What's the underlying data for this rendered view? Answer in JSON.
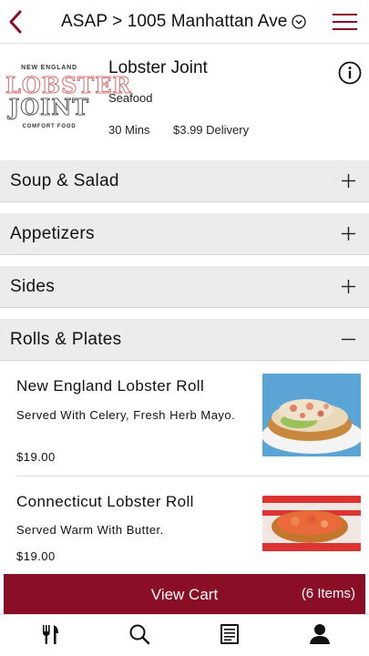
{
  "header": {
    "address": "ASAP > 1005 Manhattan Ave"
  },
  "restaurant": {
    "logo": {
      "top_line": "NEW ENGLAND",
      "line1": "LOBSTER",
      "line2": "JOINT",
      "bottom_line": "COMFORT FOOD"
    },
    "name": "Lobster Joint",
    "cuisine": "Seafood",
    "time": "30 Mins",
    "delivery_fee": "$3.99 Delivery"
  },
  "categories": [
    {
      "label": "Soup & Salad",
      "expanded": false
    },
    {
      "label": "Appetizers",
      "expanded": false
    },
    {
      "label": "Sides",
      "expanded": false
    },
    {
      "label": "Rolls & Plates",
      "expanded": true
    }
  ],
  "items": [
    {
      "name": "New England Lobster Roll",
      "description": "Served With Celery, Fresh Herb Mayo.",
      "price": "$19.00"
    },
    {
      "name": "Connecticut Lobster Roll",
      "description": "Served Warm With Butter.",
      "price": "$19.00"
    }
  ],
  "cart": {
    "label": "View Cart",
    "count": "(6 Items)"
  },
  "tabs": [
    {
      "icon": "utensils-icon"
    },
    {
      "icon": "search-icon"
    },
    {
      "icon": "menu-book-icon"
    },
    {
      "icon": "user-icon"
    }
  ],
  "colors": {
    "brand": "#8a0f26",
    "category_bg": "#ececec"
  }
}
